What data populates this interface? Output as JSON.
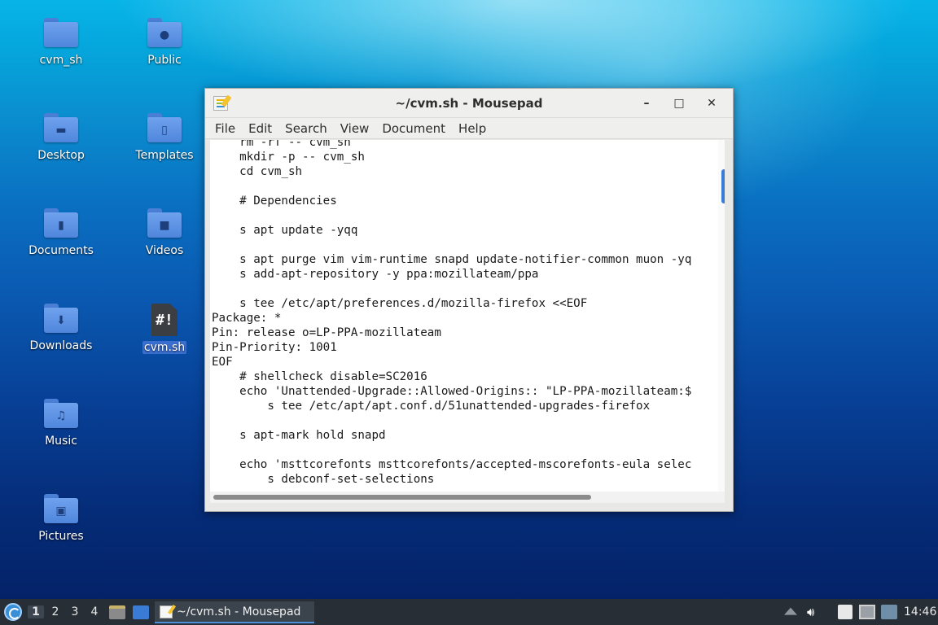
{
  "desktop": {
    "icons": [
      {
        "label": "cvm_sh",
        "icon": "folder-icon"
      },
      {
        "label": "Public",
        "icon": "folder-public-icon"
      },
      {
        "label": "Desktop",
        "icon": "folder-desktop-icon"
      },
      {
        "label": "Templates",
        "icon": "folder-templates-icon"
      },
      {
        "label": "Documents",
        "icon": "folder-documents-icon"
      },
      {
        "label": "Videos",
        "icon": "folder-videos-icon"
      },
      {
        "label": "Downloads",
        "icon": "folder-downloads-icon"
      },
      {
        "label": "cvm.sh",
        "icon": "shell-script-file-icon",
        "selected": true
      },
      {
        "label": "Music",
        "icon": "folder-music-icon"
      },
      {
        "label": "Pictures",
        "icon": "folder-pictures-icon"
      }
    ],
    "script_glyph": "#!"
  },
  "window": {
    "title": "~/cvm.sh - Mousepad",
    "controls": {
      "minimize": "–",
      "maximize": "□",
      "close": "✕"
    },
    "menu": [
      "File",
      "Edit",
      "Search",
      "View",
      "Document",
      "Help"
    ],
    "lines": [
      "    rm -rf -- cvm_sh",
      "    mkdir -p -- cvm_sh",
      "    cd cvm_sh",
      "",
      "    # Dependencies",
      "",
      "    s apt update -yqq",
      "",
      "    s apt purge vim vim-runtime snapd update-notifier-common muon -yq",
      "    s add-apt-repository -y ppa:mozillateam/ppa",
      "",
      "    s tee /etc/apt/preferences.d/mozilla-firefox <<EOF",
      "Package: *",
      "Pin: release o=LP-PPA-mozillateam",
      "Pin-Priority: 1001",
      "EOF",
      "    # shellcheck disable=SC2016",
      "    echo 'Unattended-Upgrade::Allowed-Origins:: \"LP-PPA-mozillateam:$",
      "        s tee /etc/apt/apt.conf.d/51unattended-upgrades-firefox",
      "",
      "    s apt-mark hold snapd",
      "",
      "    echo 'msttcorefonts msttcorefonts/accepted-mscorefonts-eula selec",
      "        s debconf-set-selections"
    ]
  },
  "taskbar": {
    "workspaces": [
      "1",
      "2",
      "3",
      "4"
    ],
    "active_workspace": "1",
    "task_label": "~/cvm.sh - Mousepad",
    "clock": "14:46",
    "accent": "#4e8fd8"
  }
}
